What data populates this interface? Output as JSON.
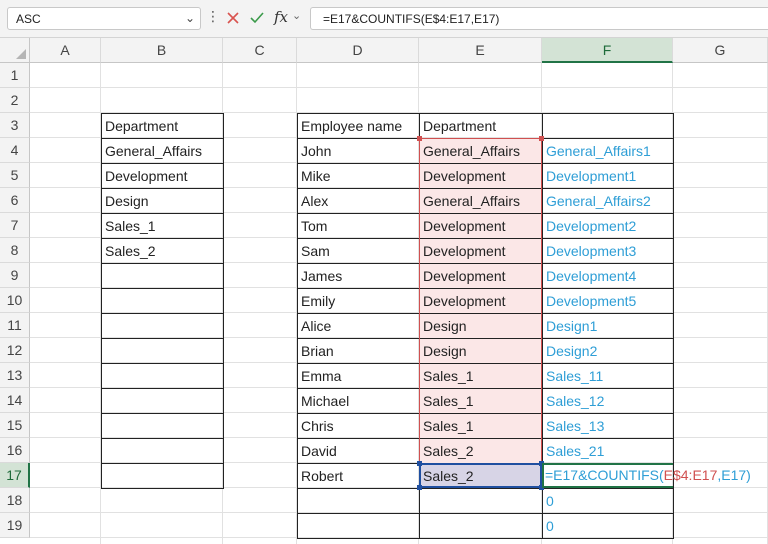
{
  "formula_bar": {
    "name_box": "ASC",
    "formula": "=E17&COUNTIFS(E$4:E17,E17)"
  },
  "columns": [
    "A",
    "B",
    "C",
    "D",
    "E",
    "F",
    "G"
  ],
  "rows": [
    "1",
    "2",
    "3",
    "4",
    "5",
    "6",
    "7",
    "8",
    "9",
    "10",
    "11",
    "12",
    "13",
    "14",
    "15",
    "16",
    "17",
    "18",
    "19"
  ],
  "dept_table": {
    "header": "Department",
    "items": [
      "General_Affairs",
      "Development",
      "Design",
      "Sales_1",
      "Sales_2"
    ]
  },
  "emp_table": {
    "col_name": "Employee name",
    "col_dept": "Department",
    "rows": [
      {
        "name": "John",
        "dept": "General_Affairs",
        "key": "General_Affairs1"
      },
      {
        "name": "Mike",
        "dept": "Development",
        "key": "Development1"
      },
      {
        "name": "Alex",
        "dept": "General_Affairs",
        "key": "General_Affairs2"
      },
      {
        "name": "Tom",
        "dept": "Development",
        "key": "Development2"
      },
      {
        "name": "Sam",
        "dept": "Development",
        "key": "Development3"
      },
      {
        "name": "James",
        "dept": "Development",
        "key": "Development4"
      },
      {
        "name": "Emily",
        "dept": "Development",
        "key": "Development5"
      },
      {
        "name": "Alice",
        "dept": "Design",
        "key": "Design1"
      },
      {
        "name": "Brian",
        "dept": "Design",
        "key": "Design2"
      },
      {
        "name": "Emma",
        "dept": "Sales_1",
        "key": "Sales_11"
      },
      {
        "name": "Michael",
        "dept": "Sales_1",
        "key": "Sales_12"
      },
      {
        "name": "Chris",
        "dept": "Sales_1",
        "key": "Sales_13"
      },
      {
        "name": "David",
        "dept": "Sales_2",
        "key": "Sales_21"
      },
      {
        "name": "Robert",
        "dept": "Sales_2",
        "key": ""
      },
      {
        "name": "",
        "dept": "",
        "key": "0"
      },
      {
        "name": "",
        "dept": "",
        "key": "0"
      }
    ],
    "editing_formula": {
      "part1": "=E17&COUNTIFS(",
      "ref": "E$4:E17",
      "part2": ",E17)"
    }
  },
  "colors": {
    "accent_green": "#217346",
    "result_blue": "#2e9ed6",
    "range_red": "#d05050",
    "range_fill": "#fbe7e7",
    "active_fill": "#d7d4e6"
  }
}
